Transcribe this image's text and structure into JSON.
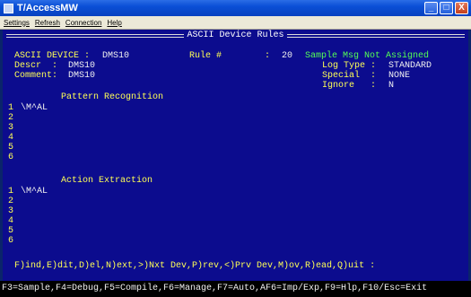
{
  "window": {
    "title": "T/AccessMW",
    "menu": [
      "Settings",
      "Refresh",
      "Connection",
      "Help"
    ],
    "buttons": [
      "_",
      "□",
      "X"
    ]
  },
  "screen": {
    "title": "ASCII Device Rules",
    "device_label": "ASCII DEVICE :",
    "device_value": "DMS10",
    "rule_label": "Rule #",
    "rule_sep": ":",
    "rule_value": "20",
    "status_msg": "Sample Msg Not Assigned",
    "descr_label": "Descr  :",
    "descr_value": "DMS10",
    "comment_label": "Comment:",
    "comment_value": "DMS10",
    "log_type_label": "Log Type :",
    "log_type_value": "STANDARD",
    "special_label": "Special  :",
    "special_value": "NONE",
    "ignore_label": "Ignore   :",
    "ignore_value": "N",
    "pattern_heading": "Pattern Recognition",
    "pattern_lines": [
      {
        "num": "1",
        "text": "\\M^AL"
      },
      {
        "num": "2",
        "text": ""
      },
      {
        "num": "3",
        "text": ""
      },
      {
        "num": "4",
        "text": ""
      },
      {
        "num": "5",
        "text": ""
      },
      {
        "num": "6",
        "text": ""
      }
    ],
    "action_heading": "Action Extraction",
    "action_lines": [
      {
        "num": "1",
        "text": "\\M^AL"
      },
      {
        "num": "2",
        "text": ""
      },
      {
        "num": "3",
        "text": ""
      },
      {
        "num": "4",
        "text": ""
      },
      {
        "num": "5",
        "text": ""
      },
      {
        "num": "6",
        "text": ""
      }
    ],
    "command_line": "F)ind,E)dit,D)el,N)ext,>)Nxt Dev,P)rev,<)Prv Dev,M)ov,R)ead,Q)uit :",
    "fkeys": "F3=Sample,F4=Debug,F5=Compile,F6=Manage,F7=Auto,AF6=Imp/Exp,F9=Hlp,F10/Esc=Exit"
  },
  "colors": {
    "background": "#0c0c8e",
    "label": "#ffff55",
    "value": "#f0f0f0",
    "status": "#55ff55",
    "titlebar": "#0a4fd6"
  }
}
